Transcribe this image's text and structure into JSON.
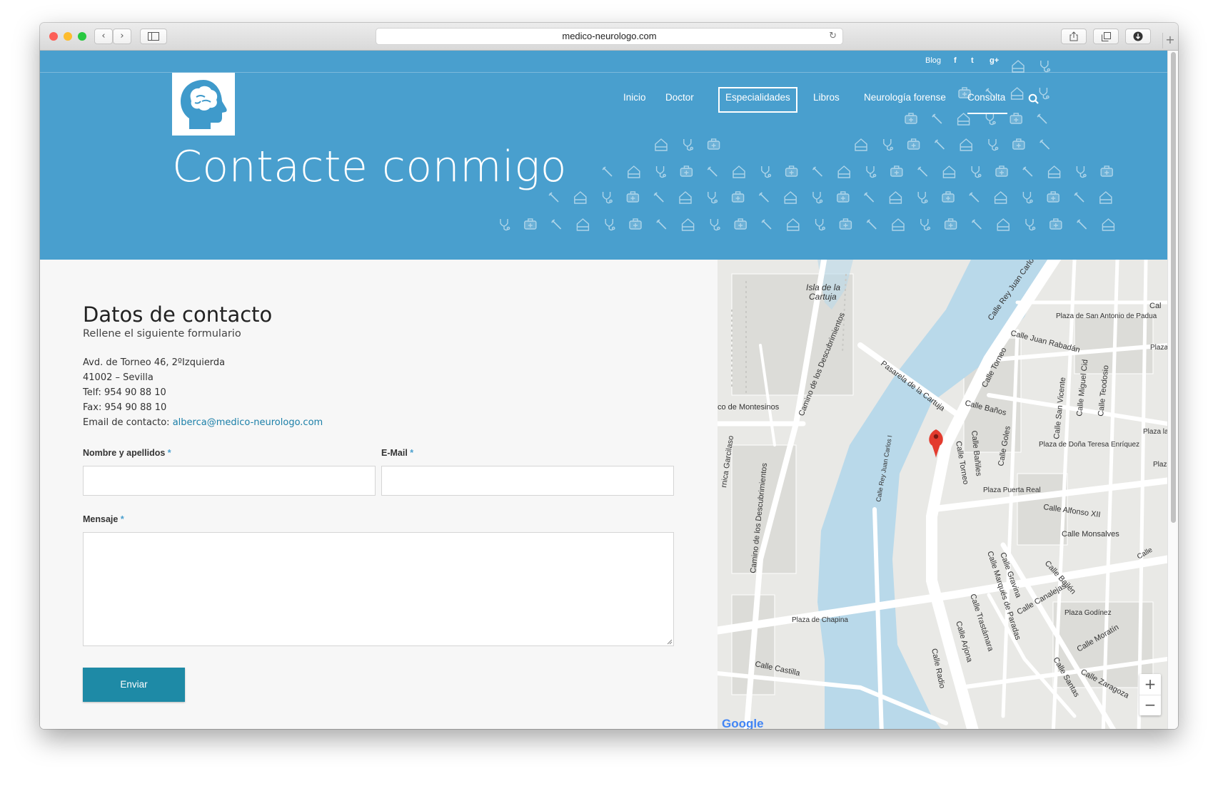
{
  "browser": {
    "url": "medico-neurologo.com",
    "back_icon": "‹",
    "forward_icon": "›"
  },
  "topbar": {
    "blog": "Blog",
    "facebook": "f",
    "twitter": "t",
    "gplus": "g+"
  },
  "nav": {
    "items": [
      "Inicio",
      "Doctor",
      "Especialidades",
      "Libros",
      "Neurología forense",
      "Consulta"
    ]
  },
  "hero": {
    "title": "Contacte conmigo"
  },
  "contact": {
    "heading": "Datos de contacto",
    "subheading": "Rellene el siguiente formulario",
    "address": "Avd. de Torneo 46, 2ºIzquierda",
    "city": "41002 – Sevilla",
    "phone": "Telf: 954 90 88 10",
    "fax": "Fax: 954 90 88 10",
    "email_label": "Email de contacto: ",
    "email": "alberca@medico-neurologo.com"
  },
  "form": {
    "name_label": "Nombre y apellidos",
    "email_label": "E-Mail",
    "message_label": "Mensaje",
    "required_mark": "*",
    "submit_label": "Enviar"
  },
  "map": {
    "labels": {
      "isla": "Isla de la",
      "cartuja": "Cartuja",
      "camino_desc_top": "Camino de los Descubrimientos",
      "pasarela": "Pasarela de la Cartuja",
      "montesinos": "co de Montesinos",
      "garcilaso": "rnica Garcilaso",
      "camino_desc_bottom": "Camino de los Descubrimientos",
      "rey_juan_carlos": "Calle Rey Juan Carlos",
      "rey_juan_carlos_i": "Calle Rey Juan Carlos I",
      "torneo1": "Calle Torneo",
      "torneo2": "Calle Torneo",
      "plaza_san_antonio": "Plaza de San Antonio de Padua",
      "juan_rabadan": "Calle Juan Rabadán",
      "banos": "Calle Baños",
      "baniles": "Calle Bañiles",
      "goles": "Calle Goles",
      "san_vicente": "Calle San Vicente",
      "miguel_cid": "Calle Miguel Cid",
      "teodosio": "Calle Teodosio",
      "plaza_dona_teresa": "Plaza de Doña Teresa Enríquez",
      "plaza_puerta_real": "Plaza Puerta Real",
      "alfonso_xii": "Calle Alfonso XII",
      "monsalves": "Calle Monsalves",
      "bailen": "Calle Bailén",
      "canalejas": "Calle Canalejas",
      "plaza_godinez": "Plaza Godínez",
      "moratin": "Calle Moratín",
      "marques_paradas": "Calle Marqués de Paradas",
      "gravina": "Calle Gravina",
      "trastamara": "Calle Trastámara",
      "arjona": "Calle Arjona",
      "radio": "Calle Radio",
      "castilla": "Calle Castilla",
      "plaza_chapina": "Plaza de Chapina",
      "zaragoza": "Calle Zaragoza",
      "santas": "Calle Santas",
      "cal": "Cal",
      "plaza_lo": "Plaza Lo",
      "plaza_gavi": "Plaza la Gavi",
      "plaza_c": "Plaza Co",
      "calle_right": "Calle",
      "google": "Google"
    },
    "zoom_in": "+",
    "zoom_out": "−"
  }
}
